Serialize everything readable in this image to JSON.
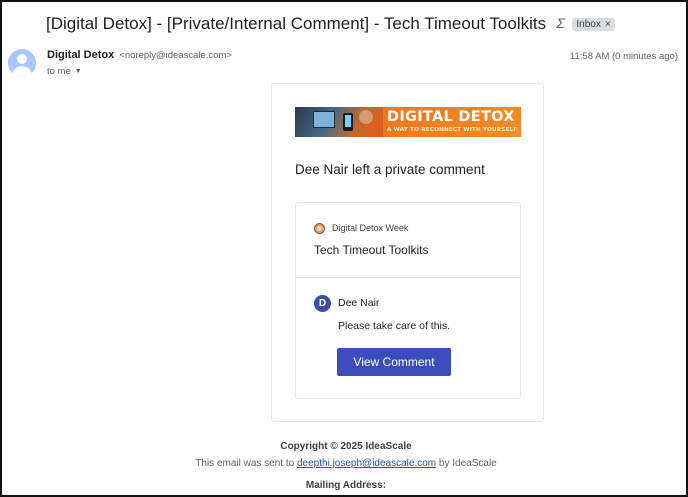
{
  "email": {
    "subject": "[Digital Detox] - [Private/Internal Comment] - Tech Timeout Toolkits",
    "inbox_label": "Inbox",
    "inbox_remove": "×",
    "label_icon": "important-marker-icon",
    "sender_name": "Digital Detox",
    "sender_email": "<noreply@ideascale.com>",
    "recipient": "to me",
    "timestamp": "11:58 AM (0 minutes ago)"
  },
  "banner": {
    "title": "DIGITAL DETOX",
    "subtitle": "A WAY TO RECONNECT WITH YOURSELF",
    "colors": {
      "background": "#f07a1f",
      "text": "#ffffff"
    }
  },
  "notification": {
    "headline": "Dee Nair left a private comment",
    "campaign": "Digital Detox Week",
    "idea_title": "Tech Timeout Toolkits",
    "commenter_initial": "D",
    "commenter_name": "Dee Nair",
    "comment": "Please take care of this.",
    "button_label": "View Comment",
    "colors": {
      "button": "#3b4dbd",
      "avatar": "#3c4fa7"
    }
  },
  "footer": {
    "copyright": "Copyright © 2025 IdeaScale",
    "sent_prefix": "This email was sent to ",
    "sent_email": "deepthi.joseph@ideascale.com",
    "sent_suffix": " by IdeaScale",
    "mailing_address_label": "Mailing Address:"
  }
}
